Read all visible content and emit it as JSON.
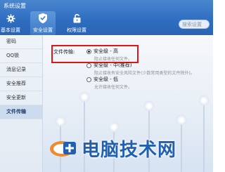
{
  "window": {
    "title": "系统设置"
  },
  "toolbar": {
    "items": [
      {
        "label": "基本设置",
        "icon": "gear-icon"
      },
      {
        "label": "安全设置",
        "icon": "shield-icon"
      },
      {
        "label": "权限设置",
        "icon": "lock-icon"
      }
    ],
    "search_placeholder": "搜索设置"
  },
  "sidebar": {
    "items": [
      {
        "label": "密码"
      },
      {
        "label": "QQ锁"
      },
      {
        "label": "消息记录"
      },
      {
        "label": "安全推荐"
      },
      {
        "label": "安全更新"
      },
      {
        "label": "文件传输"
      }
    ],
    "active": "文件传输"
  },
  "main": {
    "section_label": "文件传输:",
    "options": [
      {
        "label": "安全级 - 高",
        "desc": "阻止接收任何文件。"
      },
      {
        "label": "安全级 - 中(推荐)",
        "desc": "阻止接收有安全风险文件(少数常用类型的文件除外)。"
      },
      {
        "label": "安全级 - 低",
        "desc": "允许接收任何文件。"
      }
    ],
    "selected_index": 0
  },
  "watermark": {
    "text": "电脑技术网"
  },
  "colors": {
    "accent": "#2f6ec1",
    "highlight": "#e01616",
    "watermark": "#1f5fb4"
  }
}
